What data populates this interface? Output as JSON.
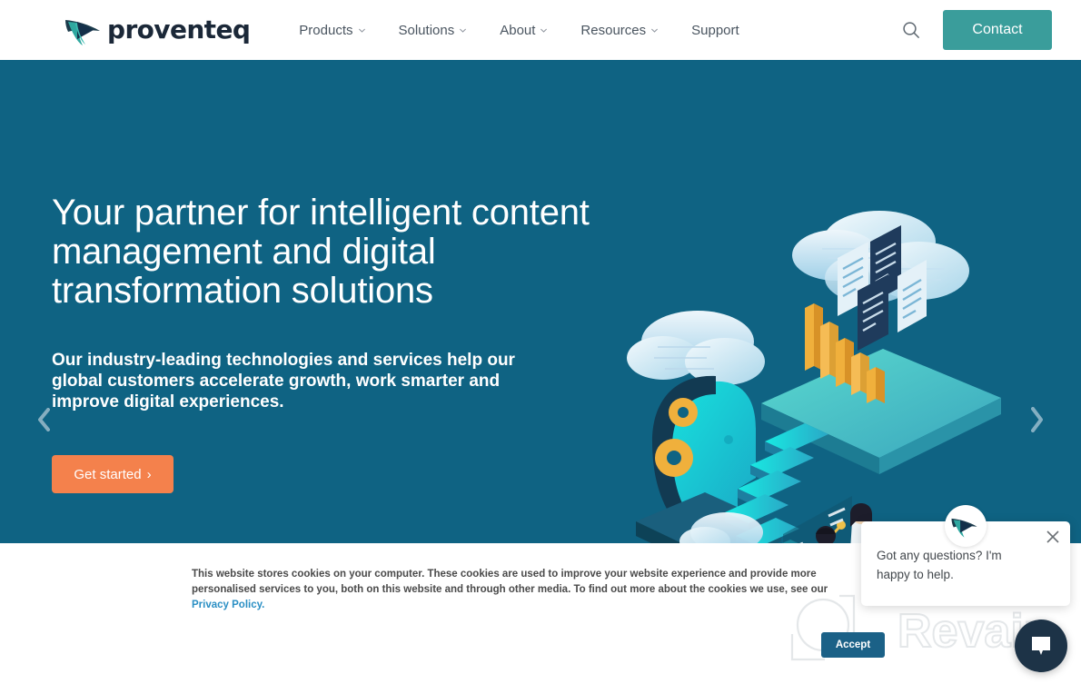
{
  "brand": {
    "name": "proventeq",
    "logo_icon": "proventeq-swoosh-logo",
    "teal": "#3a9d9b",
    "navy": "#1b2838"
  },
  "header": {
    "nav": [
      {
        "label": "Products",
        "has_dropdown": true
      },
      {
        "label": "Solutions",
        "has_dropdown": true
      },
      {
        "label": "About",
        "has_dropdown": true
      },
      {
        "label": "Resources",
        "has_dropdown": true
      },
      {
        "label": "Support",
        "has_dropdown": false
      }
    ],
    "search_icon": "search-icon",
    "contact_label": "Contact"
  },
  "hero": {
    "background": "#0f6383",
    "title": "Your partner for intelligent content management and digital transformation solutions",
    "subtitle": "Our industry-leading technologies and services help our global customers accelerate growth, work smarter and improve digital experiences.",
    "cta_label": "Get started",
    "cta_arrow": "›",
    "cta_color": "#f4814c",
    "prev_icon": "chevron-left-icon",
    "next_icon": "chevron-right-icon",
    "illustration": "isometric-cloud-content-management-illustration"
  },
  "cookie": {
    "text_part1": "This website stores cookies on your computer. These cookies are used to improve your website experience and provide more personalised services to you, both on this website and through other media. To find out more about the cookies we use, see our ",
    "link_label": "Privacy Policy.",
    "accept_label": "Accept",
    "link_color": "#2a8fc4"
  },
  "chat": {
    "message": "Got any questions? I'm happy to help.",
    "close_icon": "close-icon",
    "avatar_icon": "proventeq-swoosh-logo",
    "launcher_icon": "chat-bubble-icon",
    "launcher_color": "#1d3347"
  },
  "watermark": {
    "text": "Revain",
    "icon": "revain-outline-logo"
  }
}
